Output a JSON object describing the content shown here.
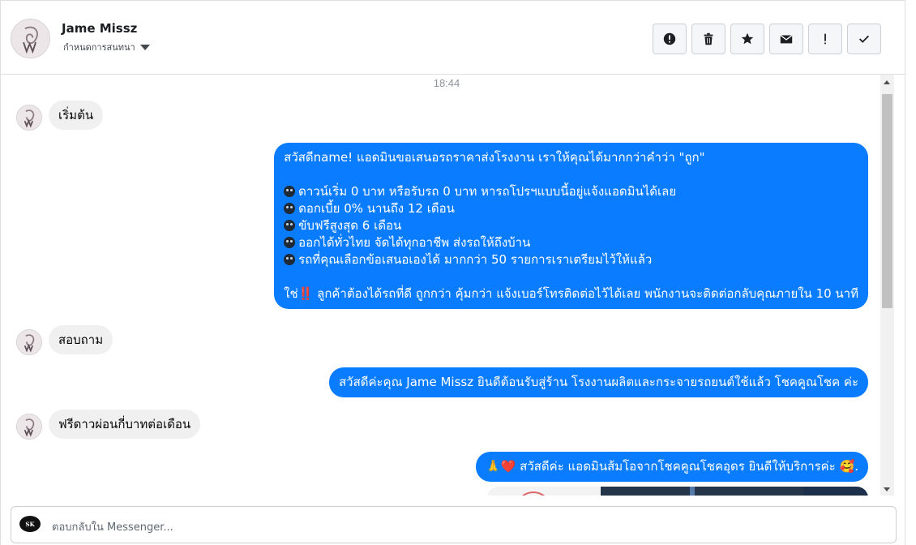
{
  "header": {
    "name": "Jame Missz",
    "subtitle": "กำหนดการสนทนา",
    "actions": [
      {
        "icon": "exclamation-circle-icon",
        "label": "⚠"
      },
      {
        "icon": "trash-icon",
        "label": "🗑"
      },
      {
        "icon": "star-icon",
        "label": "★"
      },
      {
        "icon": "envelope-icon",
        "label": "✉"
      },
      {
        "icon": "exclamation-icon",
        "label": "!"
      },
      {
        "icon": "check-icon",
        "label": "✓"
      }
    ]
  },
  "chat": {
    "timestamp": "18:44",
    "messages": [
      {
        "from": "customer",
        "text": "เริ่มต้น"
      },
      {
        "from": "page",
        "lines": [
          "สวัสดีname! แอดมินขอเสนอรถราคาส่งโรงงาน เราให้คุณได้มากกว่าคำว่า \"ถูก\"",
          "ดาวน์เริ่ม 0 บาท หรือรับรถ 0 บาท หารถโปรฯแบบนี้อยู่แจ้งแอดมินได้เลย",
          "ดอกเบี้ย 0% นานถึง 12 เดือน",
          "ขับฟรีสูงสุด 6 เดือน",
          "ออกได้ทั่วไทย จัดได้ทุกอาชีพ ส่งรถให้ถึงบ้าน",
          "รถที่คุณเลือกข้อเสนอเองได้ มากกว่า 50 รายการเราเตรียมไว้ให้แล้ว",
          "ใช่‼️ ลูกค้าต้องได้รถที่ดี ถูกกว่า คุ้มกว่า แจ้งเบอร์โทรติดต่อไว้ได้เลย พนักงานจะติดต่อกลับคุณภายใน 10 นาที"
        ]
      },
      {
        "from": "customer",
        "text": "สอบถาม"
      },
      {
        "from": "page",
        "text": "สวัสดีค่ะคุณ Jame Missz ยินดีต้อนรับสู่ร้าน โรงงานผลิตและกระจายรถยนต์ใช้แล้ว โชคคูณโชค ค่ะ"
      },
      {
        "from": "customer",
        "text": "ฟรีดาวผ่อนกี่บาทต่อเดือน"
      },
      {
        "from": "page",
        "text": "🙏❤️ สวัสดีค่ะ แอดมินส้มโอจากโชคคูณโชคอุดร ยินดีให้บริการค่ะ 🥰."
      }
    ]
  },
  "composer": {
    "logo_text": "SK",
    "placeholder": "ตอบกลับใน Messenger..."
  },
  "colors": {
    "outgoing_bubble": "#0a7cff",
    "incoming_bubble": "#f0f0f0"
  }
}
